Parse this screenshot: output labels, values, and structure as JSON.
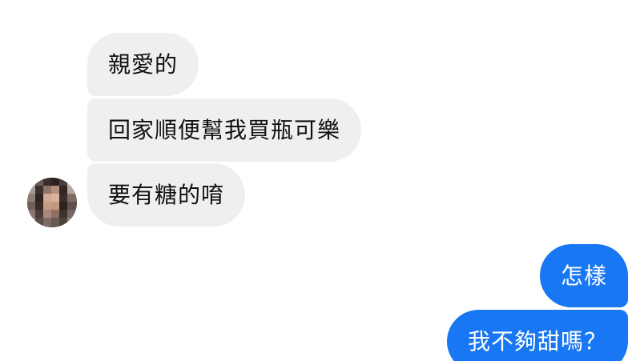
{
  "conversation": {
    "contact": {
      "avatar_icon": "pixelated-profile-photo"
    },
    "messages": [
      {
        "direction": "incoming",
        "text": "親愛的"
      },
      {
        "direction": "incoming",
        "text": "回家順便幫我買瓶可樂"
      },
      {
        "direction": "incoming",
        "text": "要有糖的唷"
      },
      {
        "direction": "outgoing",
        "text": "怎樣"
      },
      {
        "direction": "outgoing",
        "text": "我不夠甜嗎？"
      }
    ]
  },
  "colors": {
    "incoming_bubble": "#eeeff1",
    "outgoing_bubble": "#1877f2",
    "incoming_text": "#111111",
    "outgoing_text": "#ffffff"
  }
}
